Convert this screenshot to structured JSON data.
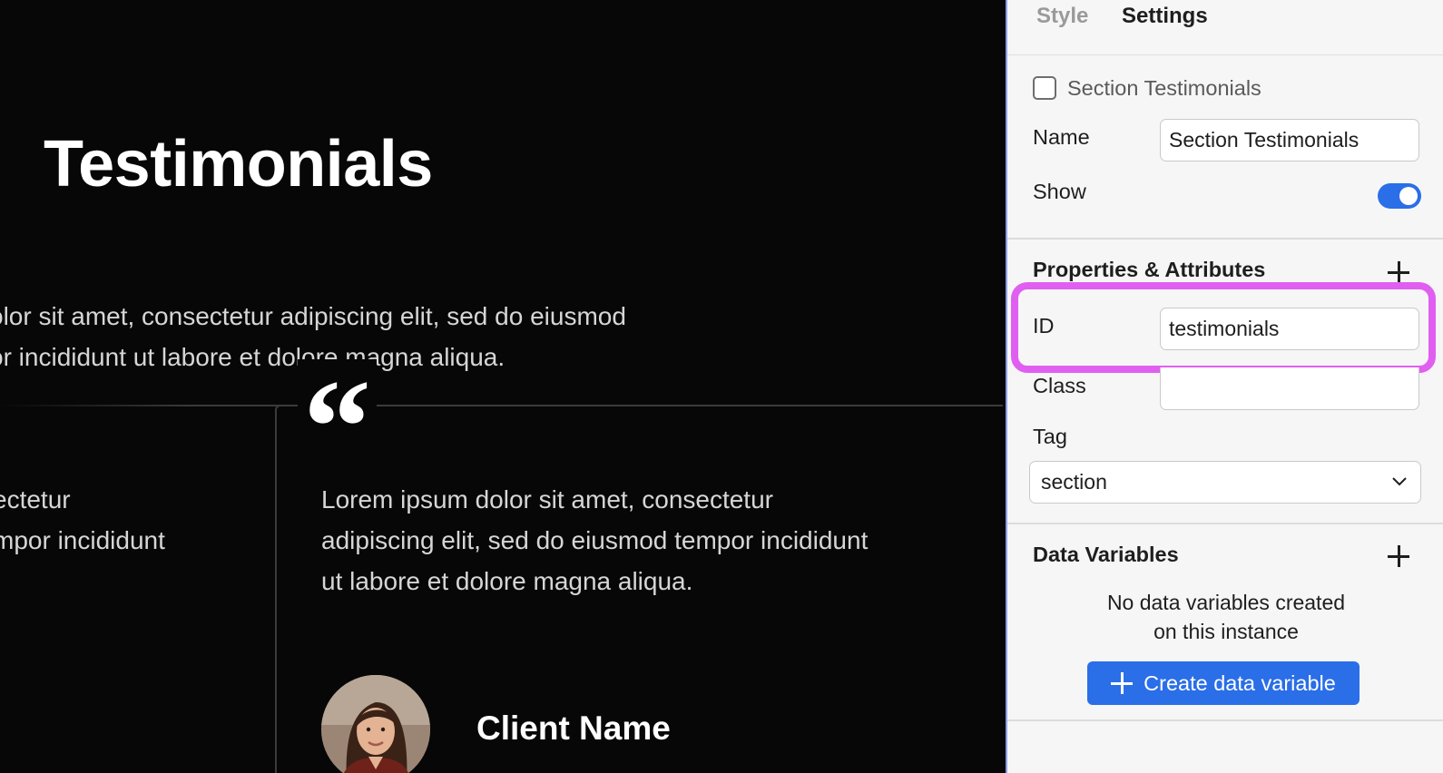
{
  "canvas": {
    "title": "Testimonials",
    "intro_text": "olor sit amet, consectetur adipiscing elit, sed do eiusmod\nor incididunt ut labore et dolore magna aliqua.",
    "left_card_text": "ectetur\nmpor incididunt",
    "quote_glyph": "“",
    "card_text": "Lorem ipsum dolor sit amet, consectetur\nadipiscing elit, sed do eiusmod tempor incididunt\nut labore et dolore magna aliqua.",
    "client_name": "Client Name"
  },
  "panel": {
    "tabs": [
      {
        "label": "Style",
        "active": false
      },
      {
        "label": "Settings",
        "active": true
      }
    ],
    "element_label": "Section Testimonials",
    "name_label": "Name",
    "name_value": "Section Testimonials",
    "show_label": "Show",
    "show_enabled": true,
    "properties_title": "Properties & Attributes",
    "id_label": "ID",
    "id_value": "testimonials",
    "class_label": "Class",
    "class_value": "",
    "tag_label": "Tag",
    "tag_value": "section",
    "data_variables_title": "Data Variables",
    "empty_line1": "No data variables created",
    "empty_line2": "on this instance",
    "create_button": "Create data variable",
    "colors": {
      "accent": "#2a6ee8",
      "highlight": "#e05ff0"
    }
  }
}
